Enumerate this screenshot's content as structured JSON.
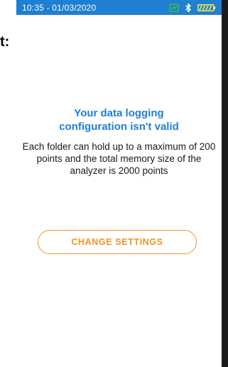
{
  "status_bar": {
    "time": "10:35 - 01/03/2020",
    "icons": [
      "connection-icon",
      "bluetooth-icon",
      "battery-icon"
    ],
    "colors": {
      "background": "#1f7fd0",
      "connection": "#3fbf3f",
      "bluetooth": "#ffffff",
      "battery": "#ffe94d"
    }
  },
  "left_fragment": {
    "text": "t:"
  },
  "dialog": {
    "title_line1": "Your data logging",
    "title_line2": "configuration isn't valid",
    "message": "Each folder can hold up to a maximum of 200 points and the total memory size of the analyzer is 2000 points",
    "button_label": "CHANGE SETTINGS"
  },
  "colors": {
    "accent_blue": "#1f7fd0",
    "button_orange": "#f0932b",
    "text": "#1a1a1a"
  }
}
